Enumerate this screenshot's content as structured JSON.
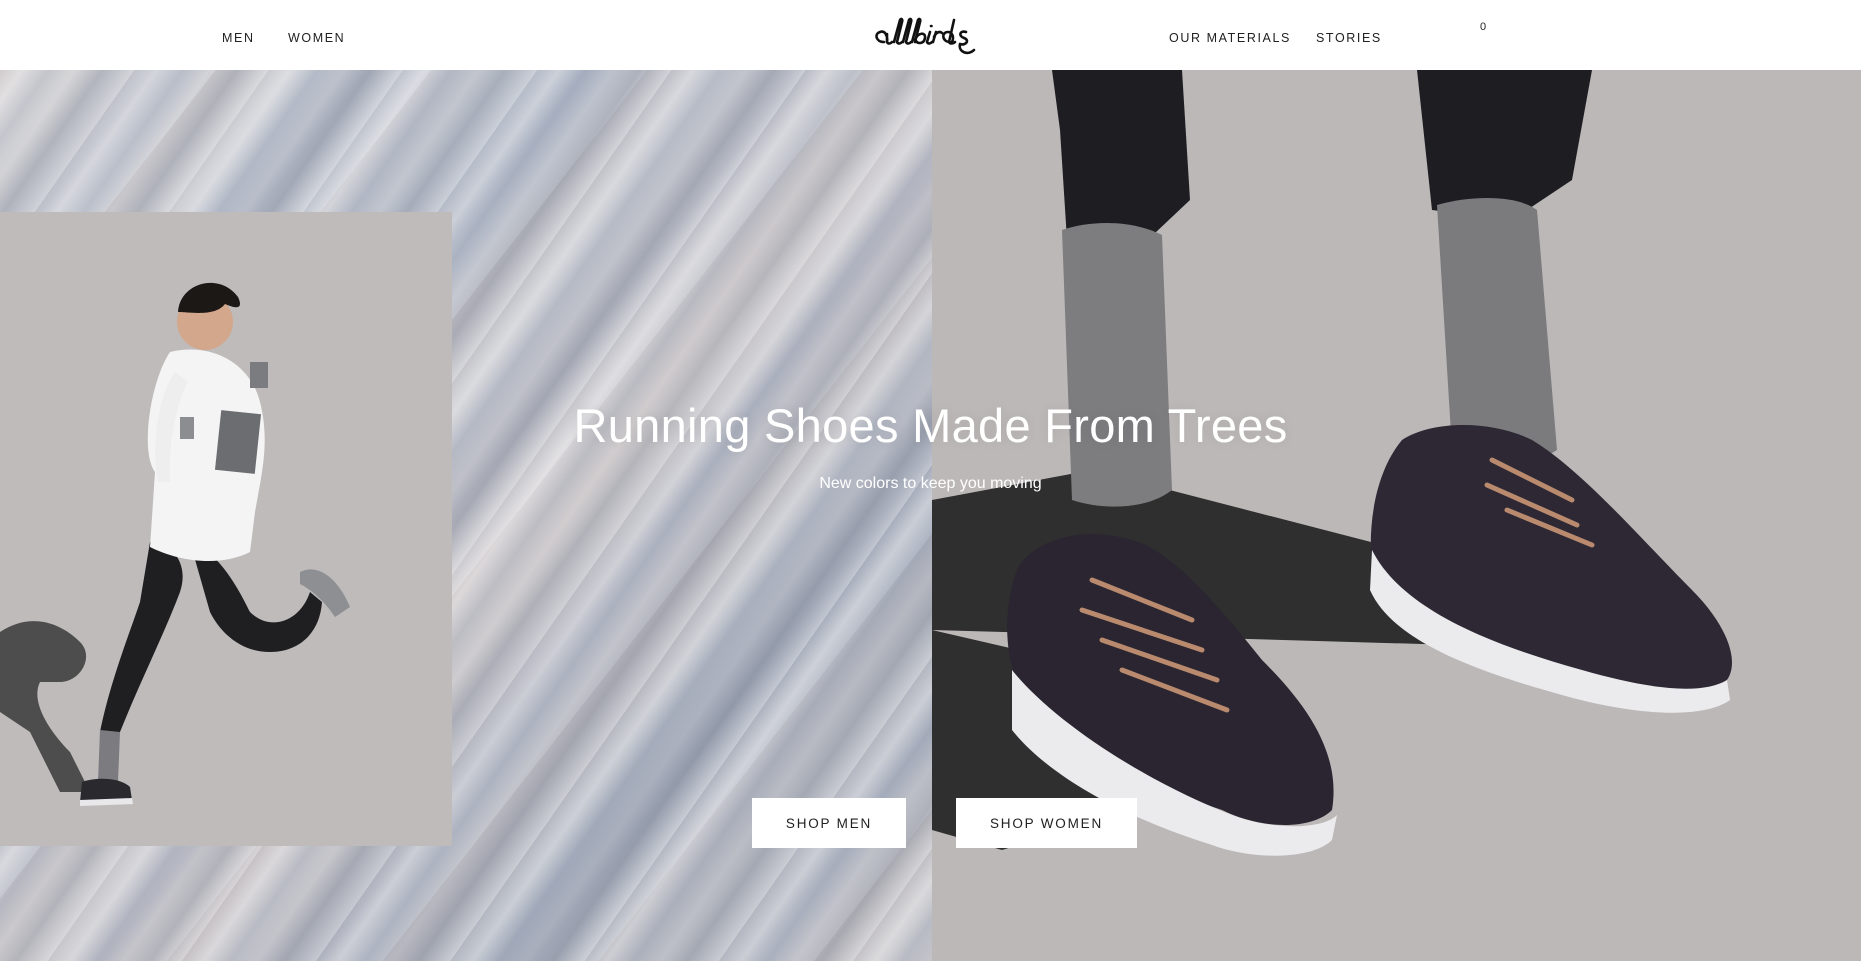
{
  "header": {
    "nav_left": [
      {
        "label": "MEN"
      },
      {
        "label": "WOMEN"
      }
    ],
    "logo_text": "allbirds",
    "nav_right": [
      {
        "label": "OUR MATERIALS"
      },
      {
        "label": "STORIES"
      }
    ],
    "cart": {
      "count": "0",
      "icon": "shopping-bag-icon"
    }
  },
  "hero": {
    "heading": "Running Shoes Made From Trees",
    "subheading": "New colors to keep you moving",
    "buttons": {
      "shop_men": "SHOP MEN",
      "shop_women": "SHOP WOMEN"
    }
  },
  "colors": {
    "text_dark": "#212121",
    "hero_right_bg": "#bdb8b8",
    "button_bg": "#ffffff"
  }
}
